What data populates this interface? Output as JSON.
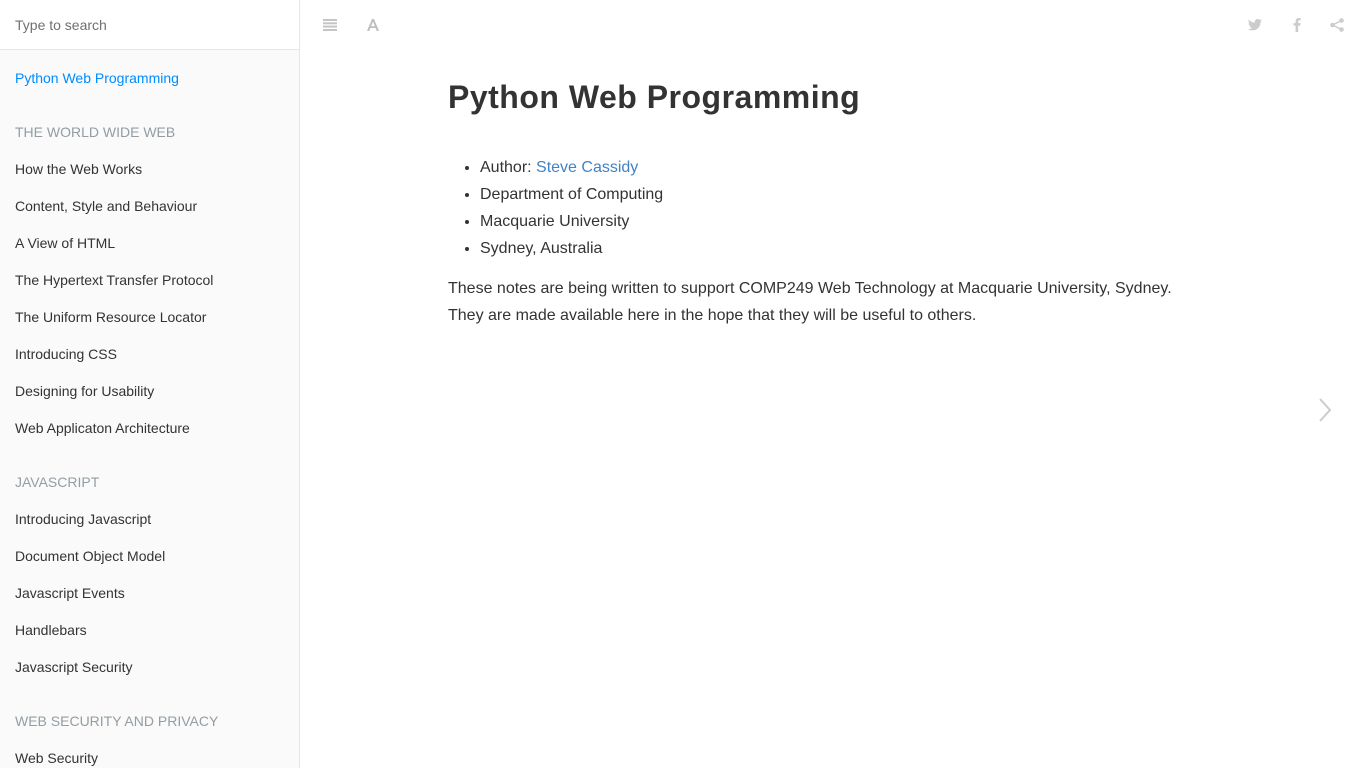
{
  "search": {
    "placeholder": "Type to search"
  },
  "sidebar": {
    "items": [
      {
        "label": "Python Web Programming",
        "type": "link",
        "active": true
      },
      {
        "label": "THE WORLD WIDE WEB",
        "type": "header"
      },
      {
        "label": "How the Web Works",
        "type": "link"
      },
      {
        "label": "Content, Style and Behaviour",
        "type": "link"
      },
      {
        "label": "A View of HTML",
        "type": "link"
      },
      {
        "label": "The Hypertext Transfer Protocol",
        "type": "link"
      },
      {
        "label": "The Uniform Resource Locator",
        "type": "link"
      },
      {
        "label": "Introducing CSS",
        "type": "link"
      },
      {
        "label": "Designing for Usability",
        "type": "link"
      },
      {
        "label": "Web Applicaton Architecture",
        "type": "link"
      },
      {
        "label": "JAVASCRIPT",
        "type": "header"
      },
      {
        "label": "Introducing Javascript",
        "type": "link"
      },
      {
        "label": "Document Object Model",
        "type": "link"
      },
      {
        "label": "Javascript Events",
        "type": "link"
      },
      {
        "label": "Handlebars",
        "type": "link"
      },
      {
        "label": "Javascript Security",
        "type": "link"
      },
      {
        "label": "WEB SECURITY AND PRIVACY",
        "type": "header"
      },
      {
        "label": "Web Security",
        "type": "link"
      }
    ]
  },
  "toolbar": {
    "left_icons": [
      "menu-icon",
      "font-settings-icon"
    ],
    "right_icons": [
      "twitter-icon",
      "facebook-icon",
      "share-icon"
    ]
  },
  "page": {
    "title": "Python Web Programming",
    "author_prefix": "Author: ",
    "author_name": "Steve Cassidy",
    "details": [
      "Department of Computing",
      "Macquarie University",
      "Sydney, Australia"
    ],
    "intro": "These notes are being written to support COMP249 Web Technology at Macquarie University, Sydney. They are made available here in the hope that they will be useful to others."
  },
  "colors": {
    "active_link": "#008cff",
    "body_link": "#4183c4",
    "section_header": "#939da3",
    "icon": "#cccccc",
    "sidebar_bg": "#fafafa"
  }
}
